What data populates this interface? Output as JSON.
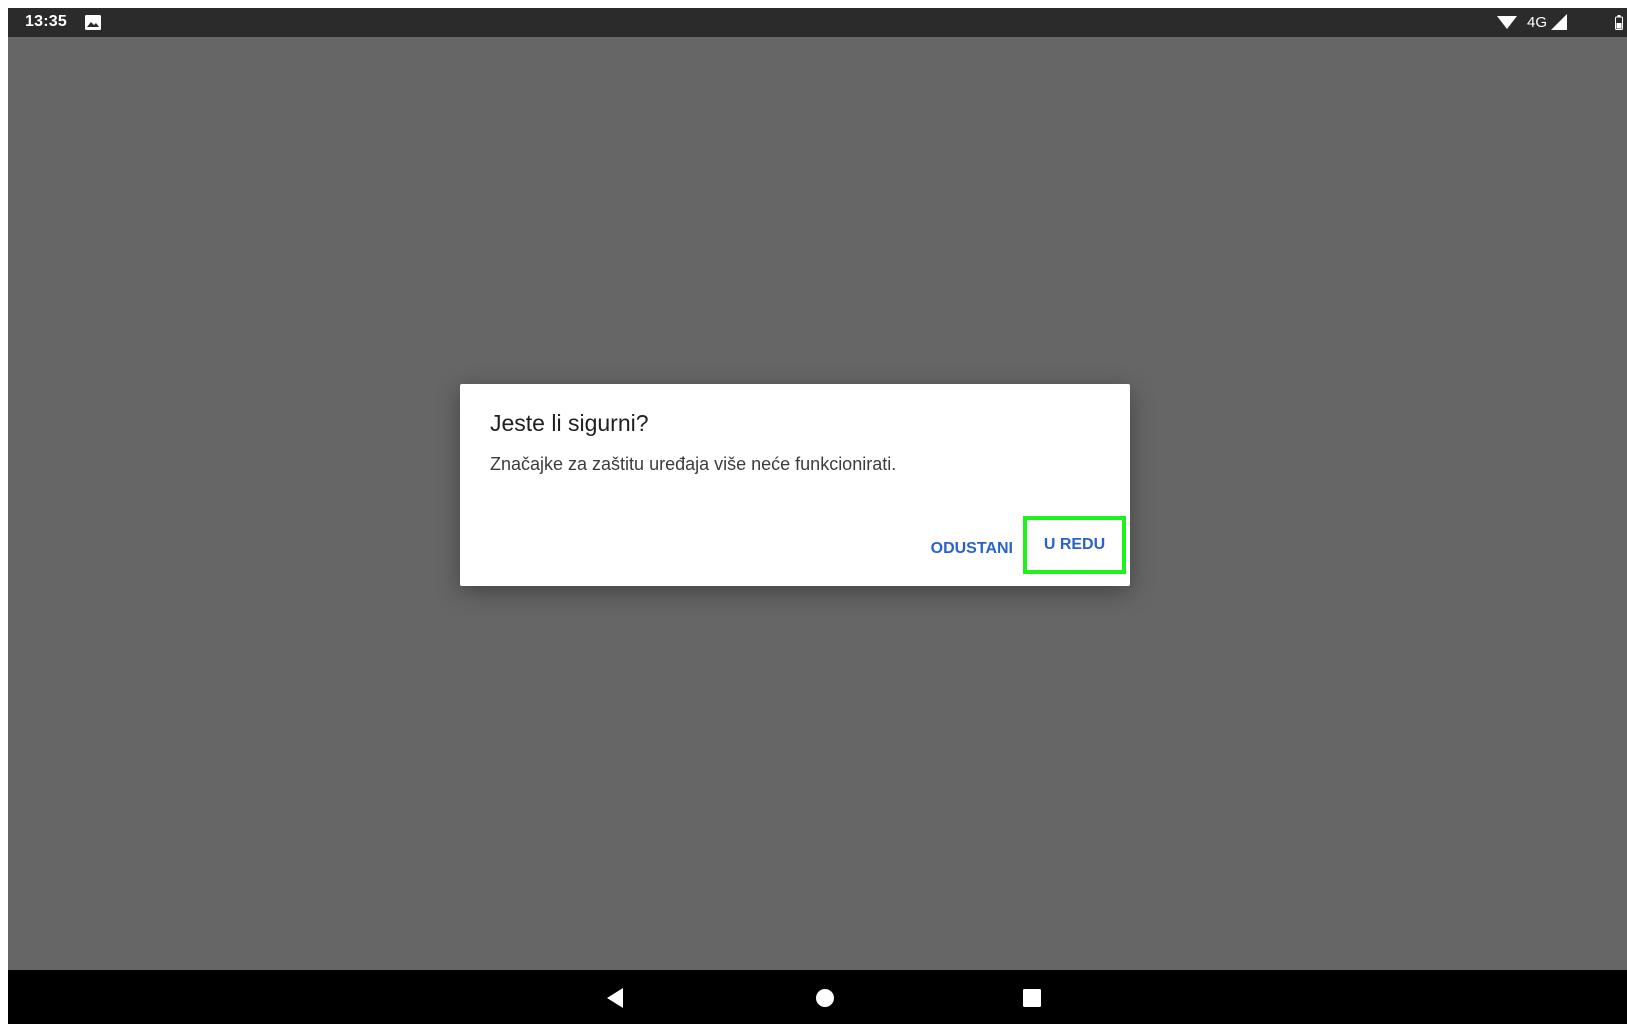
{
  "status_bar": {
    "time": "13:35",
    "network": "4G",
    "icons": [
      "gallery-icon",
      "wifi-icon",
      "signal-icon",
      "battery-icon"
    ]
  },
  "dialog": {
    "title": "Jeste li sigurni?",
    "message": "Značajke za zaštitu uređaja više neće funkcionirati.",
    "cancel_label": "ODUSTANI",
    "ok_label": "U REDU"
  },
  "nav_bar": {
    "icons": [
      "back-icon",
      "home-icon",
      "recents-icon"
    ]
  },
  "colors": {
    "scrim": "#666666",
    "status_bar": "#2b2b2b",
    "nav_bar": "#000000",
    "dialog_bg": "#ffffff",
    "accent": "#2a63c8",
    "highlight": "#1df21d"
  }
}
